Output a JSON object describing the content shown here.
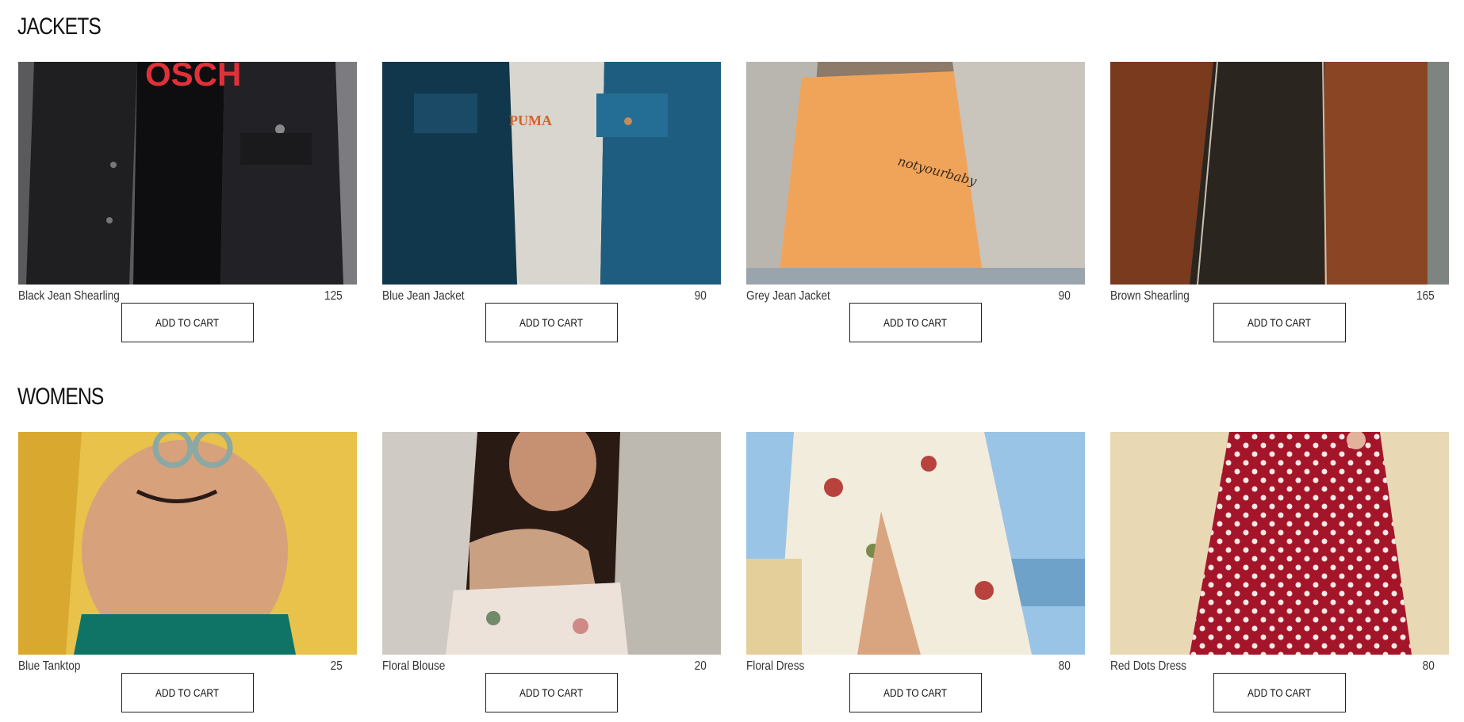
{
  "sections": [
    {
      "title": "JACKETS",
      "products": [
        {
          "name": "Black Jean Shearling",
          "price": "125",
          "button": "ADD TO CART"
        },
        {
          "name": "Blue Jean Jacket",
          "price": "90",
          "button": "ADD TO CART"
        },
        {
          "name": "Grey Jean Jacket",
          "price": "90",
          "button": "ADD TO CART"
        },
        {
          "name": "Brown Shearling",
          "price": "165",
          "button": "ADD TO CART"
        }
      ]
    },
    {
      "title": "WOMENS",
      "products": [
        {
          "name": "Blue Tanktop",
          "price": "25",
          "button": "ADD TO CART"
        },
        {
          "name": "Floral Blouse",
          "price": "20",
          "button": "ADD TO CART"
        },
        {
          "name": "Floral Dress",
          "price": "80",
          "button": "ADD TO CART"
        },
        {
          "name": "Red Dots Dress",
          "price": "80",
          "button": "ADD TO CART"
        }
      ]
    }
  ]
}
